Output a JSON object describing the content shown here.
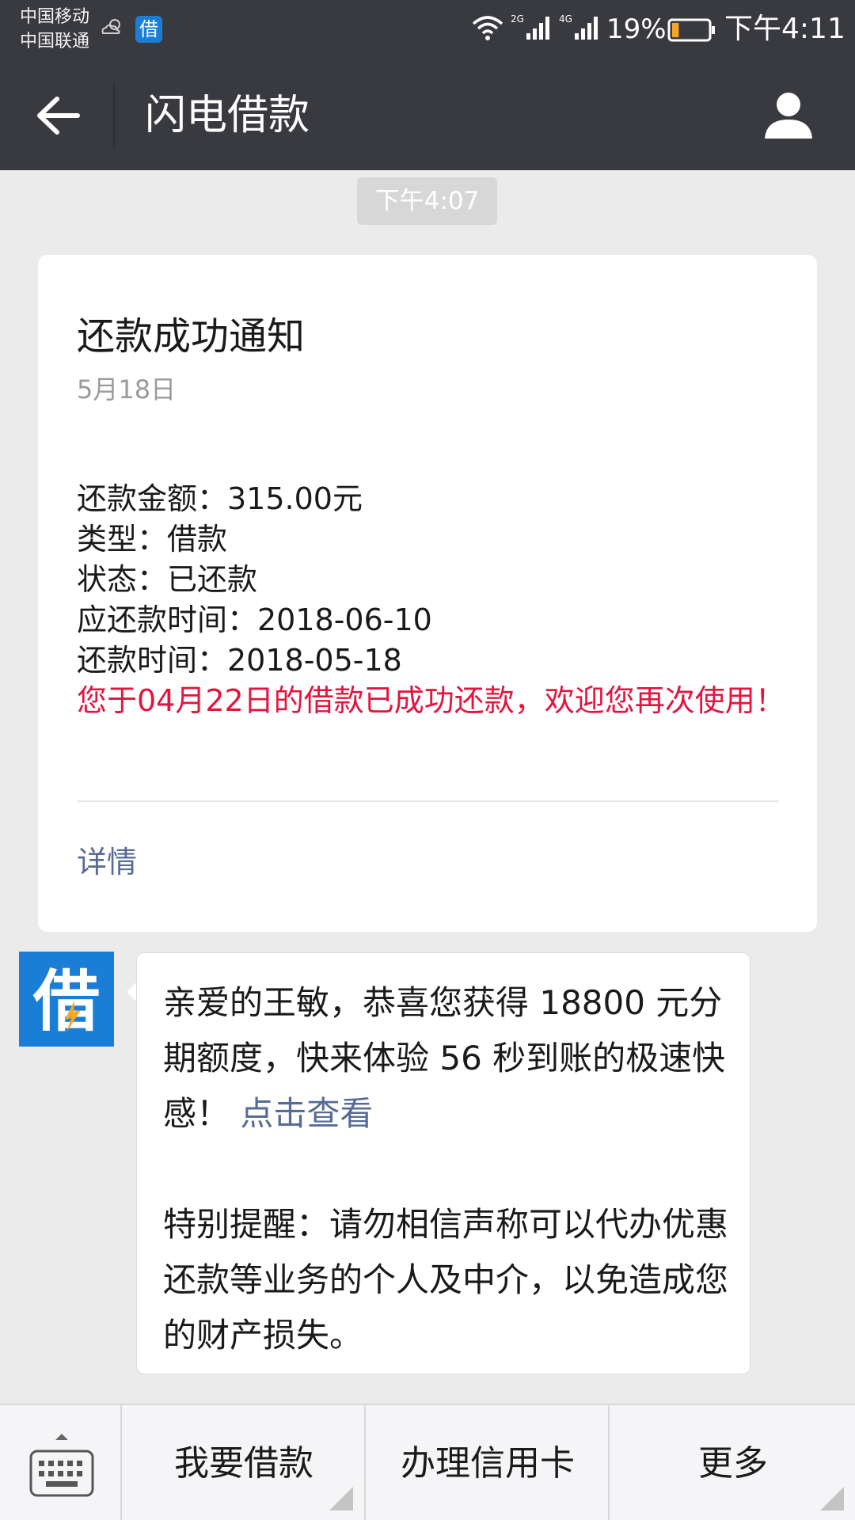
{
  "status_bar": {
    "carrier_1": "中国移动",
    "carrier_2": "中国联通",
    "app_badge": "借",
    "network_1": "2G",
    "network_2": "4G",
    "battery_percent": "19%",
    "battery_level": 0.19,
    "time": "下午4:11"
  },
  "header": {
    "title": "闪电借款",
    "back_icon": "arrow-left-icon",
    "profile_icon": "person-icon"
  },
  "chat": {
    "timestamp": "下午4:07",
    "card": {
      "title": "还款成功通知",
      "date": "5月18日",
      "fields": [
        "还款金额：315.00元",
        "类型：借款",
        "状态：已还款",
        "应还款时间：2018-06-10",
        "还款时间：2018-05-18"
      ],
      "highlight": "您于04月22日的借款已成功还款，欢迎您再次使用！",
      "detail_link": "详情"
    },
    "message": {
      "avatar_text": "借",
      "line1": "亲爱的王敏，恭喜您获得 18800 元分期额度，快来体验 56 秒到账的极速快感！",
      "link": "点击查看",
      "line2": "特别提醒：请勿相信声称可以代办优惠还款等业务的个人及中介，以免造成您的财产损失。"
    }
  },
  "bottom_menu": {
    "keyboard_icon": "keyboard-icon",
    "items": [
      "我要借款",
      "办理信用卡",
      "更多"
    ]
  },
  "colors": {
    "header_bg": "#393a3f",
    "chat_bg": "#ebebeb",
    "highlight_red": "#e3153f",
    "link_blue": "#576b95",
    "app_blue": "#1a7ed6"
  }
}
